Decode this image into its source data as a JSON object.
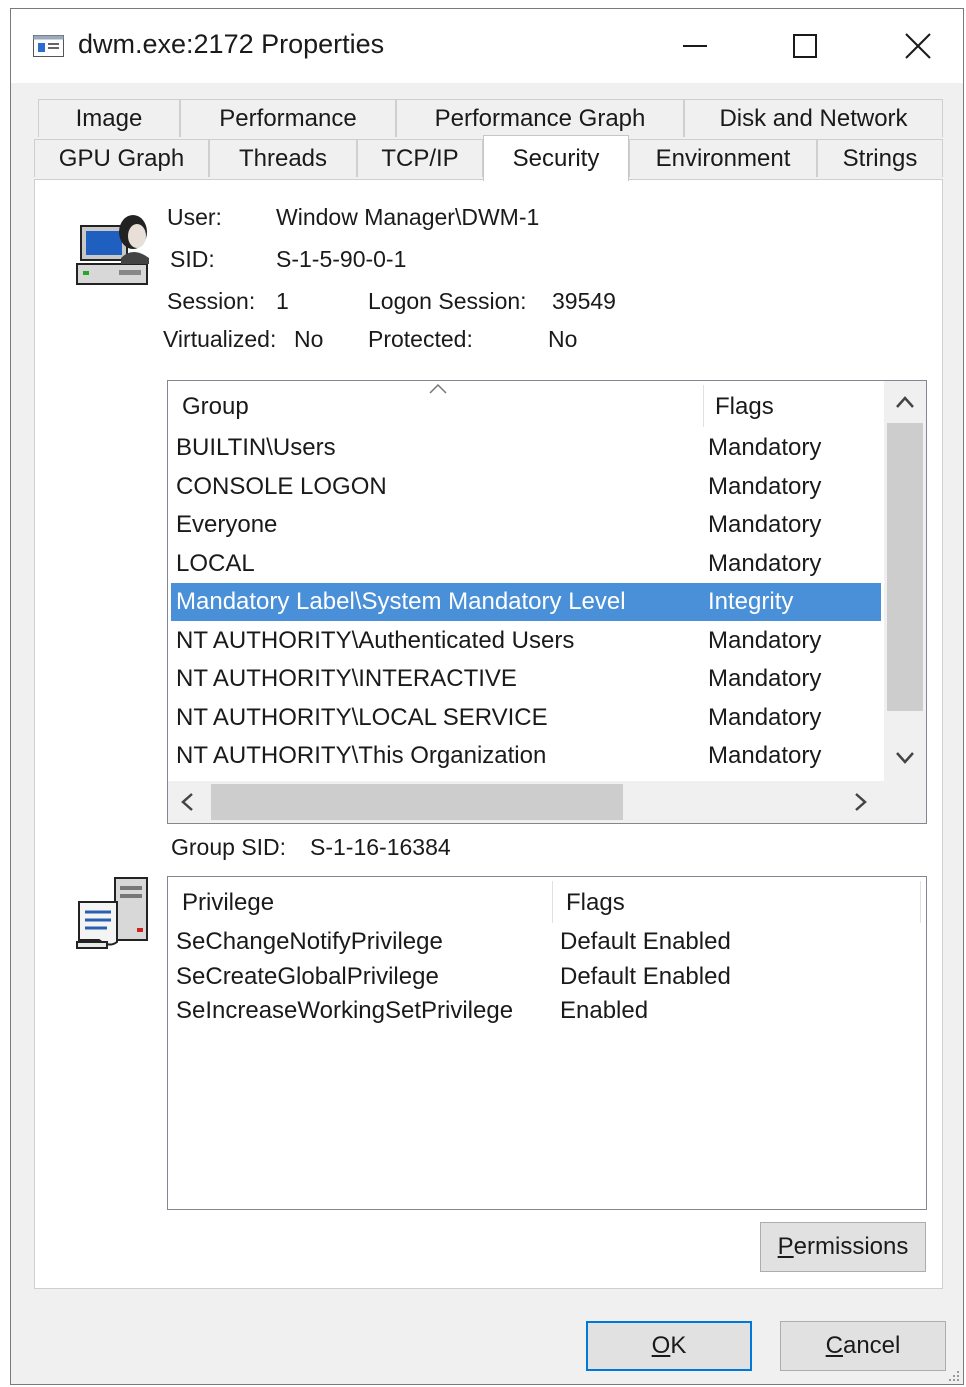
{
  "window": {
    "title": "dwm.exe:2172 Properties"
  },
  "tabs": {
    "row1": [
      "Image",
      "Performance",
      "Performance Graph",
      "Disk and Network"
    ],
    "row2": [
      "GPU Graph",
      "Threads",
      "TCP/IP",
      "Security",
      "Environment",
      "Strings"
    ],
    "active": "Security"
  },
  "security": {
    "user_label": "User:",
    "user_value": "Window Manager\\DWM-1",
    "sid_label": "SID:",
    "sid_value": "S-1-5-90-0-1",
    "session_label": "Session:",
    "session_value": "1",
    "logon_session_label": "Logon Session:",
    "logon_session_value": "39549",
    "virtualized_label": "Virtualized:",
    "virtualized_value": "No",
    "protected_label": "Protected:",
    "protected_value": "No",
    "group_sid_label": "Group SID:",
    "group_sid_value": "S-1-16-16384"
  },
  "groups": {
    "col_group": "Group",
    "col_flags": "Flags",
    "rows": [
      {
        "group": "BUILTIN\\Users",
        "flags": "Mandatory"
      },
      {
        "group": "CONSOLE LOGON",
        "flags": "Mandatory"
      },
      {
        "group": "Everyone",
        "flags": "Mandatory"
      },
      {
        "group": "LOCAL",
        "flags": "Mandatory"
      },
      {
        "group": "Mandatory Label\\System Mandatory Level",
        "flags": "Integrity",
        "selected": true
      },
      {
        "group": "NT AUTHORITY\\Authenticated Users",
        "flags": "Mandatory"
      },
      {
        "group": "NT AUTHORITY\\INTERACTIVE",
        "flags": "Mandatory"
      },
      {
        "group": "NT AUTHORITY\\LOCAL SERVICE",
        "flags": "Mandatory"
      },
      {
        "group": "NT AUTHORITY\\This Organization",
        "flags": "Mandatory"
      }
    ]
  },
  "privileges": {
    "col_privilege": "Privilege",
    "col_flags": "Flags",
    "rows": [
      {
        "privilege": "SeChangeNotifyPrivilege",
        "flags": "Default Enabled"
      },
      {
        "privilege": "SeCreateGlobalPrivilege",
        "flags": "Default Enabled"
      },
      {
        "privilege": "SeIncreaseWorkingSetPrivilege",
        "flags": "Enabled"
      }
    ]
  },
  "buttons": {
    "permissions_first": "P",
    "permissions_rest": "ermissions",
    "ok_first": "O",
    "ok_rest": "K",
    "cancel_first": "C",
    "cancel_rest": "ancel"
  },
  "colors": {
    "selection": "#4a90d9",
    "default_button_border": "#0078d7"
  }
}
